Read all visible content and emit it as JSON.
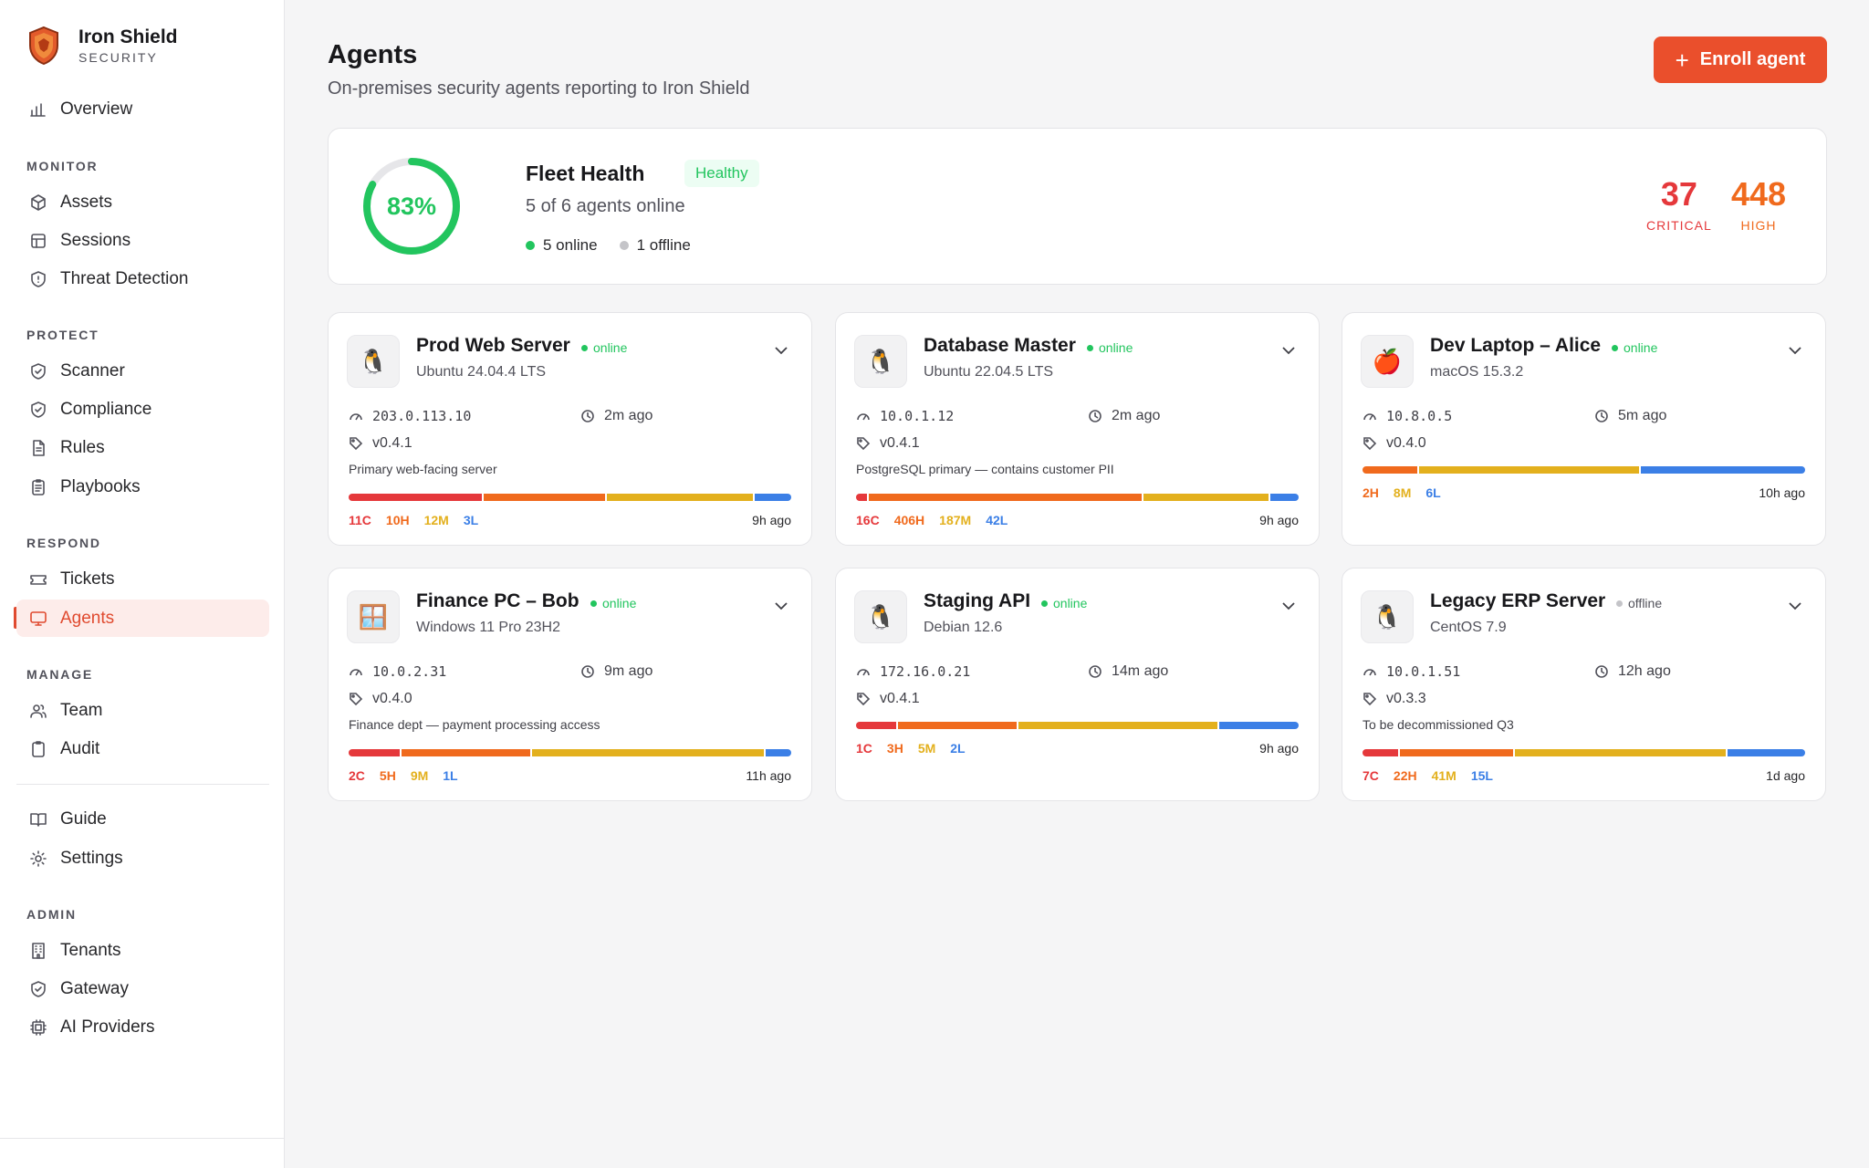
{
  "brand": {
    "name": "Iron Shield",
    "sub": "SECURITY"
  },
  "nav": {
    "overview": "Overview",
    "monitor_title": "MONITOR",
    "assets": "Assets",
    "sessions": "Sessions",
    "threat_detection": "Threat Detection",
    "protect_title": "PROTECT",
    "scanner": "Scanner",
    "compliance": "Compliance",
    "rules": "Rules",
    "playbooks": "Playbooks",
    "respond_title": "RESPOND",
    "tickets": "Tickets",
    "agents": "Agents",
    "manage_title": "MANAGE",
    "team": "Team",
    "audit": "Audit",
    "guide": "Guide",
    "settings": "Settings",
    "admin_title": "ADMIN",
    "tenants": "Tenants",
    "gateway": "Gateway",
    "ai_providers": "AI Providers"
  },
  "header": {
    "title": "Agents",
    "subtitle": "On-premises security agents reporting to Iron Shield",
    "enroll_label": "Enroll agent"
  },
  "fleet": {
    "percent_label": "83%",
    "health_fraction": 0.83,
    "title": "Fleet Health",
    "badge": "Healthy",
    "summary": "5 of 6 agents online",
    "online_label": "5 online",
    "offline_label": "1 offline",
    "critical": "37",
    "critical_label": "CRITICAL",
    "high": "448",
    "high_label": "HIGH"
  },
  "colors": {
    "accent": "#ea4f2c",
    "online": "#22c55e",
    "offline": "#c4c4c8",
    "critical": "#e5383b",
    "high": "#f06a1d",
    "medium": "#e3b01d",
    "low": "#3b7fe6"
  },
  "agents": [
    {
      "name": "Prod Web Server",
      "status": "online",
      "os": "Ubuntu 24.04.4 LTS",
      "os_icon": "penguin-icon",
      "os_glyph": "🐧",
      "ip": "203.0.113.10",
      "seen": "2m ago",
      "version": "v0.4.1",
      "desc": "Primary web-facing server",
      "c": "11C",
      "h": "10H",
      "m": "12M",
      "l": "3L",
      "scan": "9h ago",
      "counts": [
        11,
        10,
        12,
        3
      ]
    },
    {
      "name": "Database Master",
      "status": "online",
      "os": "Ubuntu 22.04.5 LTS",
      "os_icon": "penguin-icon",
      "os_glyph": "🐧",
      "ip": "10.0.1.12",
      "seen": "2m ago",
      "version": "v0.4.1",
      "desc": "PostgreSQL primary — contains customer PII",
      "c": "16C",
      "h": "406H",
      "m": "187M",
      "l": "42L",
      "scan": "9h ago",
      "counts": [
        16,
        406,
        187,
        42
      ]
    },
    {
      "name": "Dev Laptop – Alice",
      "status": "online",
      "os": "macOS 15.3.2",
      "os_icon": "apple-icon",
      "os_glyph": "🍎",
      "ip": "10.8.0.5",
      "seen": "5m ago",
      "version": "v0.4.0",
      "desc": "",
      "c": "",
      "h": "2H",
      "m": "8M",
      "l": "6L",
      "scan": "10h ago",
      "counts": [
        0,
        2,
        8,
        6
      ]
    },
    {
      "name": "Finance PC – Bob",
      "status": "online",
      "os": "Windows 11 Pro 23H2",
      "os_icon": "window-icon",
      "os_glyph": "🪟",
      "ip": "10.0.2.31",
      "seen": "9m ago",
      "version": "v0.4.0",
      "desc": "Finance dept — payment processing access",
      "c": "2C",
      "h": "5H",
      "m": "9M",
      "l": "1L",
      "scan": "11h ago",
      "counts": [
        2,
        5,
        9,
        1
      ]
    },
    {
      "name": "Staging API",
      "status": "online",
      "os": "Debian 12.6",
      "os_icon": "penguin-icon",
      "os_glyph": "🐧",
      "ip": "172.16.0.21",
      "seen": "14m ago",
      "version": "v0.4.1",
      "desc": "",
      "c": "1C",
      "h": "3H",
      "m": "5M",
      "l": "2L",
      "scan": "9h ago",
      "counts": [
        1,
        3,
        5,
        2
      ]
    },
    {
      "name": "Legacy ERP Server",
      "status": "offline",
      "os": "CentOS 7.9",
      "os_icon": "penguin-icon",
      "os_glyph": "🐧",
      "ip": "10.0.1.51",
      "seen": "12h ago",
      "version": "v0.3.3",
      "desc": "To be decommissioned Q3",
      "c": "7C",
      "h": "22H",
      "m": "41M",
      "l": "15L",
      "scan": "1d ago",
      "counts": [
        7,
        22,
        41,
        15
      ]
    }
  ]
}
